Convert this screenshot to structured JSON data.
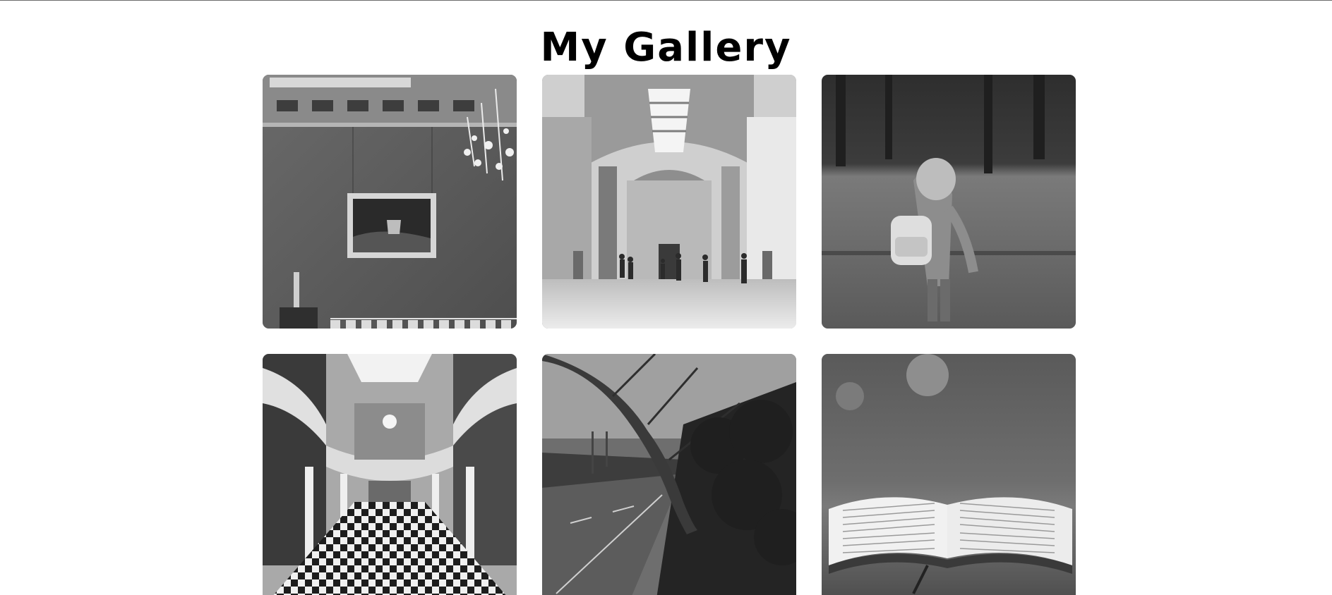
{
  "page": {
    "title": "My Gallery"
  },
  "gallery": {
    "photos": [
      {
        "subject": "museum-wall-painting-chandelier"
      },
      {
        "subject": "grand-museum-hall-visitors"
      },
      {
        "subject": "child-with-backpack-in-park"
      },
      {
        "subject": "atrium-balconies-checkered-floor"
      },
      {
        "subject": "leaning-tree-by-road"
      },
      {
        "subject": "open-book-on-table"
      }
    ]
  }
}
